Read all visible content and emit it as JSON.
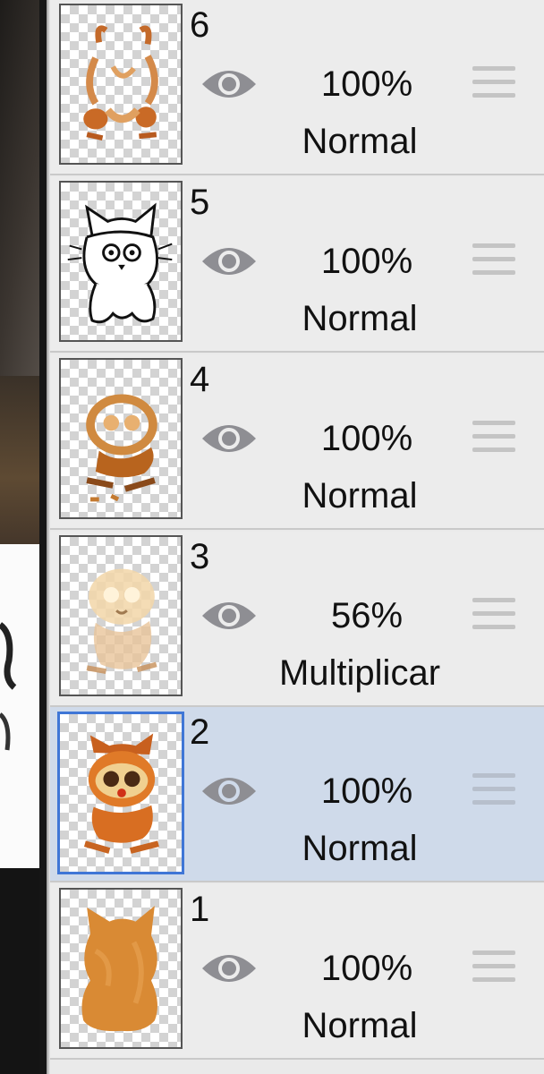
{
  "layers": [
    {
      "number": "6",
      "opacity": "100%",
      "blend_mode": "Normal",
      "selected": false,
      "thumbnail": "cat-color-strokes"
    },
    {
      "number": "5",
      "opacity": "100%",
      "blend_mode": "Normal",
      "selected": false,
      "thumbnail": "cat-lineart"
    },
    {
      "number": "4",
      "opacity": "100%",
      "blend_mode": "Normal",
      "selected": false,
      "thumbnail": "cat-shading"
    },
    {
      "number": "3",
      "opacity": "56%",
      "blend_mode": "Multiplicar",
      "selected": false,
      "thumbnail": "cat-light-shading"
    },
    {
      "number": "2",
      "opacity": "100%",
      "blend_mode": "Normal",
      "selected": true,
      "thumbnail": "cat-orange-details"
    },
    {
      "number": "1",
      "opacity": "100%",
      "blend_mode": "Normal",
      "selected": false,
      "thumbnail": "cat-base-fill"
    }
  ],
  "icons": {
    "visibility": "eye-icon",
    "reorder": "drag-handle-icon"
  },
  "colors": {
    "panel": "#eaeaea",
    "selected_row": "#cfdaea",
    "selection_border": "#3f76d6",
    "eye": "#8e8e93",
    "handle": "#c4c4c4"
  }
}
